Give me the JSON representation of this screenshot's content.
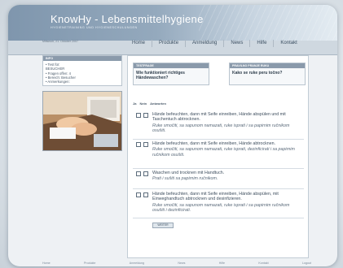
{
  "header": {
    "title": "KnowHy - Lebensmittelhygiene",
    "subtitle": "HYGIENETRAINING UND HYGIENESCHULUNGEN"
  },
  "date": "Mittwoch, 21. Oktober 2007",
  "nav": [
    "Home",
    "Produkte",
    "Anmeldung",
    "News",
    "Hilfe",
    "Kontakt"
  ],
  "sidebar": {
    "heading": "INFO",
    "items": [
      "• Test für:",
      "  BESUCHER",
      "• Fragen offen: 4",
      "• Bereich: Besucher",
      "• Anmerkungen:"
    ]
  },
  "cards": [
    {
      "head": "TESTFRAGE",
      "body": "Wie funktioniert richtiges Händewaschen?"
    },
    {
      "head": "PRAVILNO PRANJE RUKU",
      "body": "Kako se ruke peru točno?"
    }
  ],
  "columns": [
    "Ja",
    "Nein",
    "Antworten"
  ],
  "questions": [
    {
      "text": "Hände befeuchten, dann mit Seife einreiben, Hände abspülen und mit Taschentuch abtrocknen.",
      "translation": "Ruke smočiti, sa sapunom namazati, ruke isprati i sa papirnim ručnikom osušiti."
    },
    {
      "text": "Hände befeuchten, dann mit Seife einreiben, Hände abtrocknen.",
      "translation": "Ruke smočiti, sa sapunom namazati, ruke isprati, dezinficirati i sa papirnim ručnikom osušiti."
    },
    {
      "text": "Waschen und trocknen mit Handtuch.",
      "translation": "Prati i sušiti sa papirnim ručnikom."
    },
    {
      "text": "Hände befeuchten, dann mit Seife einreiben, Hände abspülen, mit Einweghandtuch abtrocknen und desinfizieren.",
      "translation": "Ruke smočiti, sa sapunom namazati, ruke isprati i sa papirnim ručnikom osušiti i dezinficirati."
    }
  ],
  "submit_label": "WEITER",
  "footer": [
    "Home",
    "Produkte",
    "Anmeldung",
    "News",
    "Hilfe",
    "Kontakt",
    "Logout"
  ]
}
